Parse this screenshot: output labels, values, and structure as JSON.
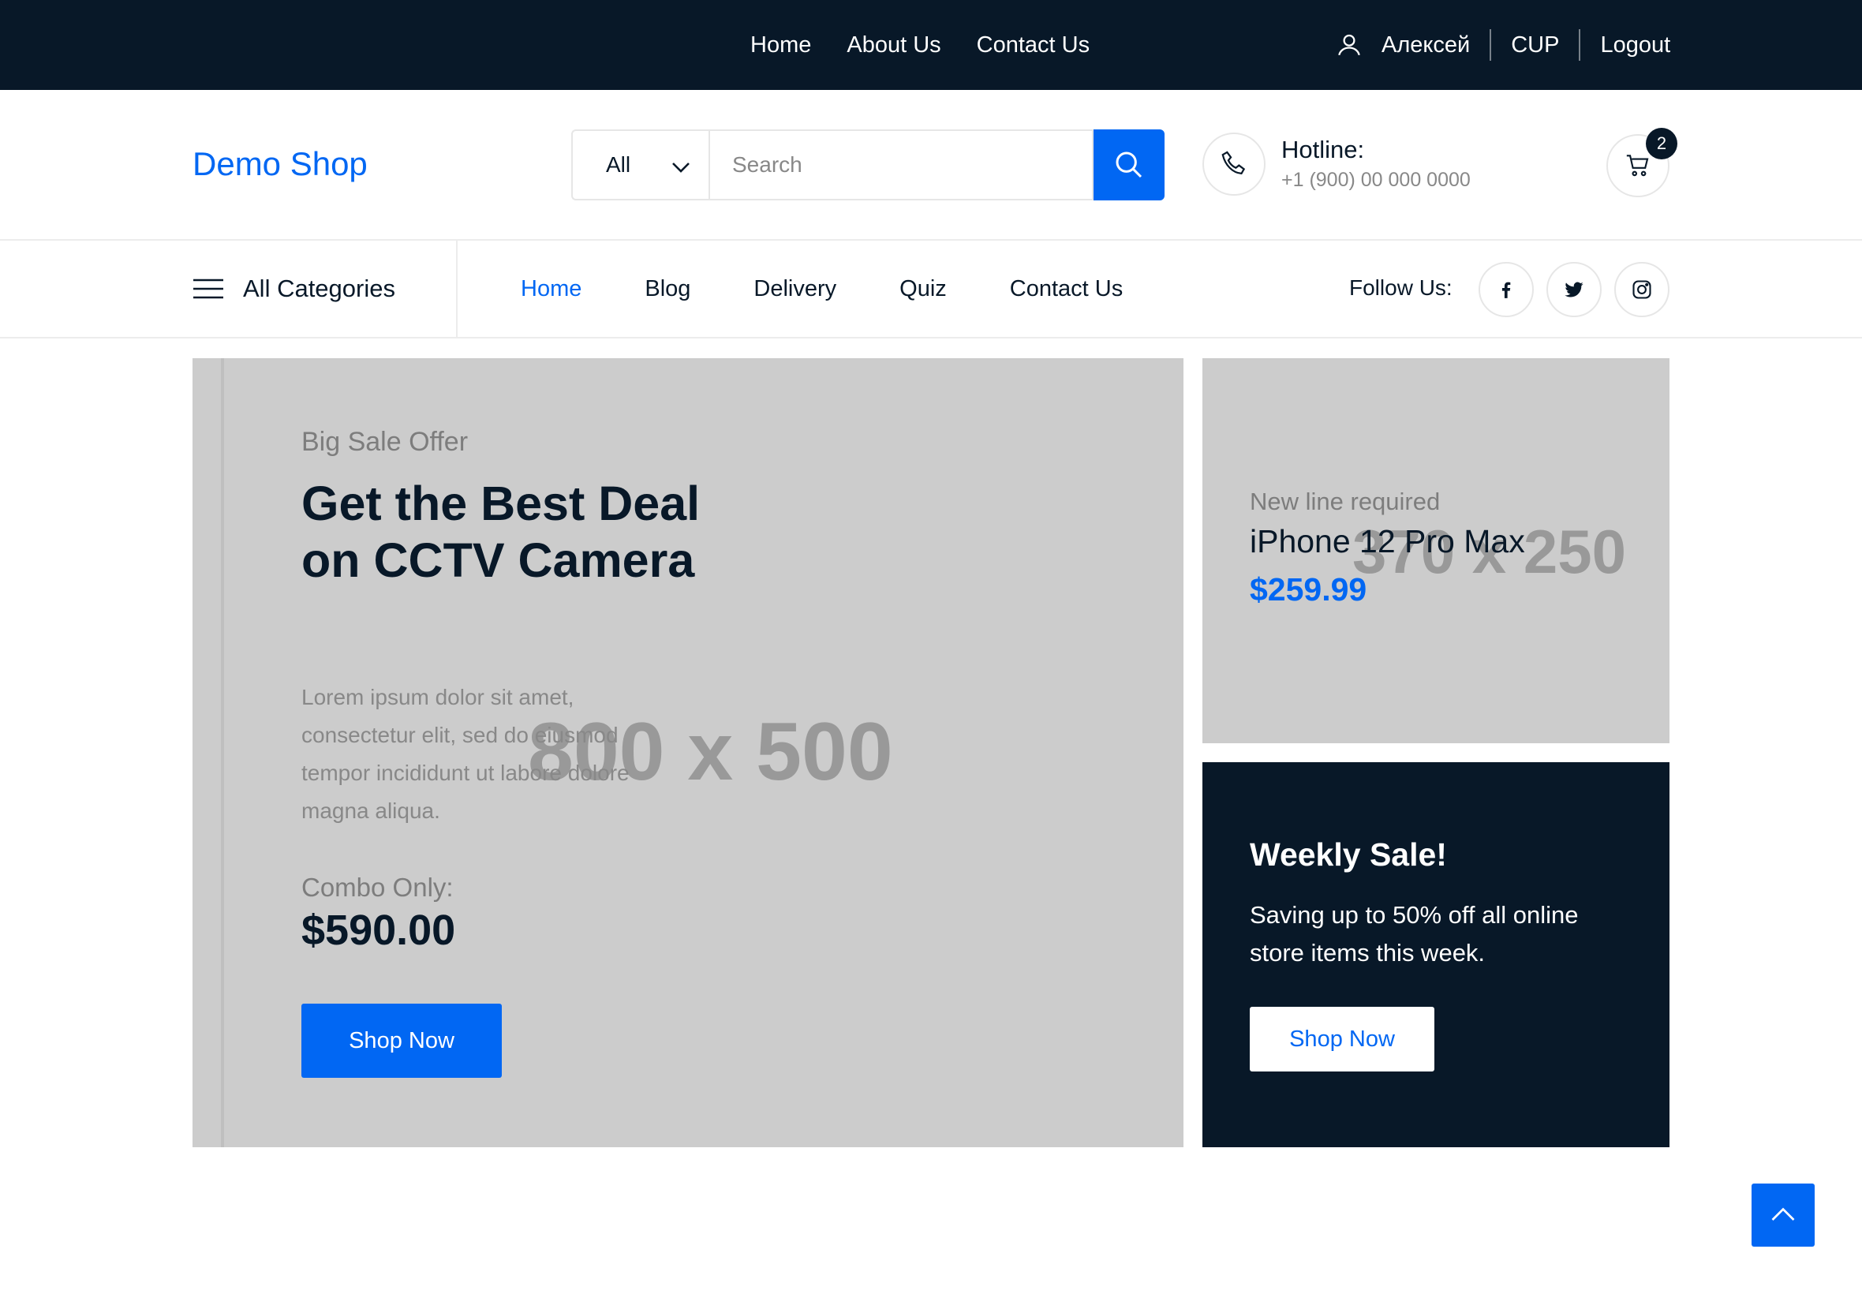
{
  "topbar": {
    "links": [
      "Home",
      "About Us",
      "Contact Us"
    ],
    "user_name": "Алексей",
    "cup_label": "CUP",
    "logout_label": "Logout"
  },
  "header": {
    "logo": "Demo Shop",
    "search": {
      "category": "All",
      "placeholder": "Search"
    },
    "hotline": {
      "title": "Hotline:",
      "number": "+1 (900) 00 000 0000"
    },
    "cart_count": "2"
  },
  "catnav": {
    "all_categories": "All Categories",
    "links": [
      "Home",
      "Blog",
      "Delivery",
      "Quiz",
      "Contact Us"
    ],
    "active": "Home",
    "follow_label": "Follow Us:"
  },
  "hero": {
    "placeholder": "800 x 500",
    "eyebrow": "Big Sale Offer",
    "title": "Get the Best Deal on CCTV Camera",
    "description": "Lorem ipsum dolor sit amet, consectetur elit, sed do eiusmod tempor incididunt ut labore dolore magna aliqua.",
    "combo_label": "Combo Only:",
    "price": "$590.00",
    "button": "Shop Now"
  },
  "card1": {
    "placeholder": "370 x 250",
    "subtitle": "New line required",
    "name": "iPhone 12 Pro Max",
    "price": "$259.99"
  },
  "card2": {
    "title": "Weekly Sale!",
    "text": "Saving up to 50% off all online store items this week.",
    "button": "Shop Now"
  },
  "colors": {
    "primary": "#0167f3",
    "dark": "#081828",
    "placeholder_bg": "#cccccc"
  },
  "icons": [
    "user-icon",
    "chevron-down-icon",
    "search-icon",
    "phone-icon",
    "cart-icon",
    "menu-icon",
    "facebook-icon",
    "twitter-icon",
    "instagram-icon",
    "chevron-up-icon"
  ]
}
